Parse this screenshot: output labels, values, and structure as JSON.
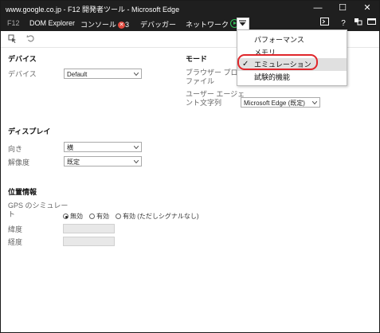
{
  "window": {
    "title": "www.google.co.jp - F12 開発者ツール - Microsoft Edge",
    "minimize": "—",
    "maximize": "☐",
    "close": "✕"
  },
  "menubar": {
    "f12": "F12",
    "dom_explorer": "DOM Explorer",
    "console": "コンソール",
    "console_errors": "3",
    "debugger": "デバッガー",
    "network": "ネットワーク",
    "right_icons": [
      "▶",
      "?",
      "↔",
      "▭"
    ]
  },
  "toolbar": {
    "select_icon": "selector-icon",
    "reset_icon": "undo-icon"
  },
  "device": {
    "section_title": "デバイス",
    "device_label": "デバイス",
    "device_value": "Default"
  },
  "mode": {
    "section_title": "モード",
    "browser_profile_label_1": "ブラウザー プロ",
    "browser_profile_label_2": "ファイル",
    "ua_label_1": "ユーザー エージェ",
    "ua_label_2": "ント文字列",
    "ua_value": "Microsoft Edge (既定)"
  },
  "display": {
    "section_title": "ディスプレイ",
    "orientation_label": "向き",
    "orientation_value": "横",
    "resolution_label": "解像度",
    "resolution_value": "既定"
  },
  "geolocation": {
    "section_title": "位置情報",
    "gps_label_1": "GPS のシミュレー",
    "gps_label_2": "ト",
    "radio_off": "無効",
    "radio_on": "有効",
    "radio_on_nosignal": "有効 (ただしシグナルなし)",
    "latitude_label": "緯度",
    "longitude_label": "経度"
  },
  "dropdown_menu": {
    "items": [
      "パフォーマンス",
      "メモリ",
      "エミュレーション",
      "試験的機能"
    ],
    "checked_index": 2,
    "check_mark": "✓"
  }
}
